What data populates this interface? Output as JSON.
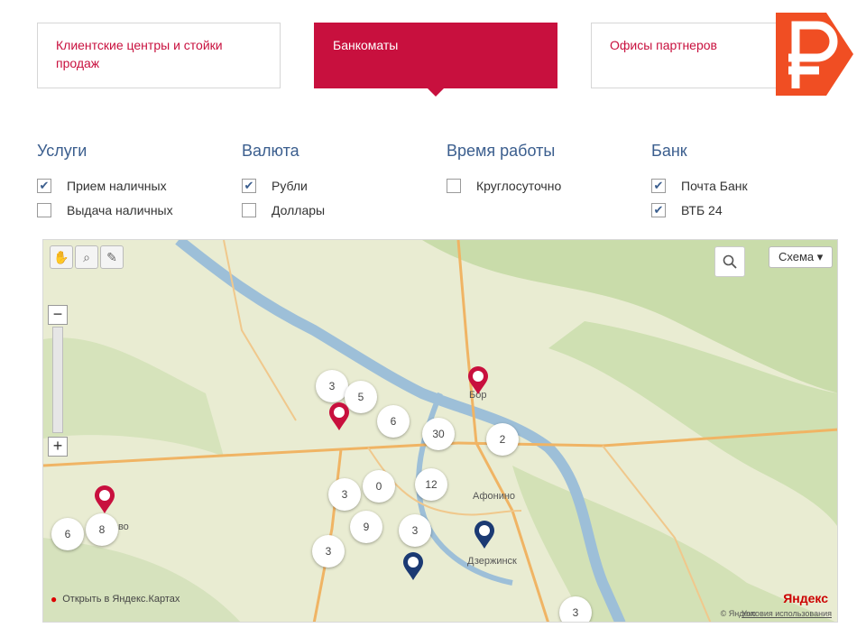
{
  "tabs": [
    {
      "label": "Клиентские центры и стойки продаж"
    },
    {
      "label": "Банкоматы"
    },
    {
      "label": "Офисы партнеров"
    }
  ],
  "filters": {
    "services": {
      "title": "Услуги",
      "options": [
        {
          "label": "Прием наличных",
          "checked": true
        },
        {
          "label": "Выдача наличных",
          "checked": false
        }
      ]
    },
    "currency": {
      "title": "Валюта",
      "options": [
        {
          "label": "Рубли",
          "checked": true
        },
        {
          "label": "Доллары",
          "checked": false
        }
      ]
    },
    "hours": {
      "title": "Время работы",
      "options": [
        {
          "label": "Круглосуточно",
          "checked": false
        }
      ]
    },
    "bank": {
      "title": "Банк",
      "options": [
        {
          "label": "Почта Банк",
          "checked": true
        },
        {
          "label": "ВТБ 24",
          "checked": true
        }
      ]
    }
  },
  "map": {
    "layer_label": "Схема ▾",
    "open_in_yandex": "Открыть в Яндекс.Картах",
    "brand": "Яндекс",
    "copyright": "© Яндекс",
    "terms": "Условия использования",
    "clusters": [
      "3",
      "5",
      "6",
      "30",
      "2",
      "3",
      "0",
      "12",
      "8",
      "6",
      "9",
      "3",
      "3",
      "3"
    ],
    "place_labels": [
      "Бор",
      "Афонино",
      "Кстово",
      "Дзержинск"
    ]
  },
  "colors": {
    "accent": "#c8103e",
    "vtb": "#1b3a73"
  }
}
